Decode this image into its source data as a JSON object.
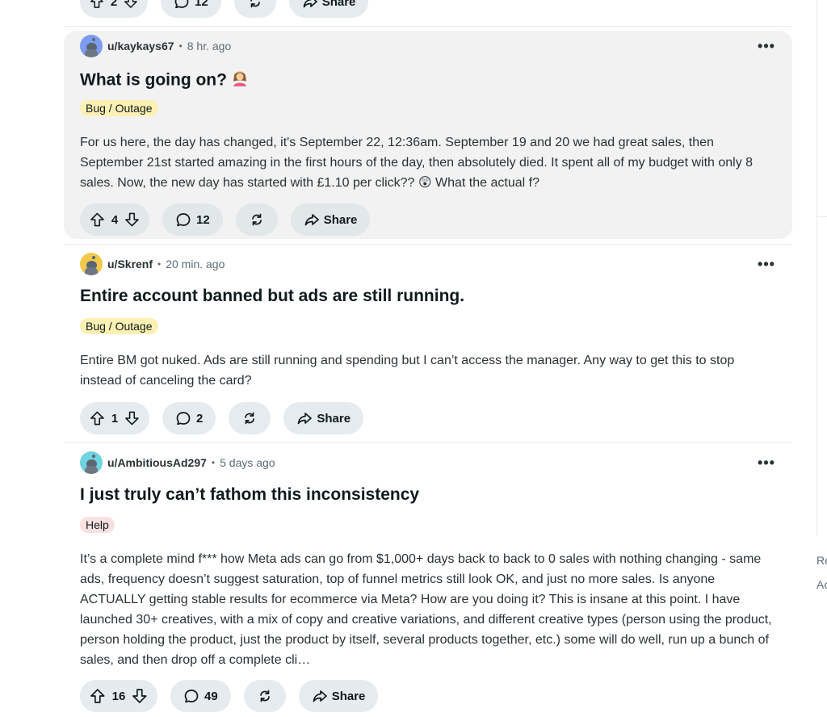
{
  "top_post": {
    "votes": "2",
    "comments": "12",
    "share_label": "Share"
  },
  "posts": [
    {
      "username": "u/kaykays67",
      "time": "8 hr. ago",
      "avatar_color": "#7d9cf0",
      "title": "What is going on?",
      "title_emoji": "woman-facepalming-emoji",
      "flair": "Bug / Outage",
      "body": "For us here, the day has changed, it's September 22, 12:36am. September 19 and 20 we had great sales, then September 21st started amazing in the first hours of the day, then absolutely died. It spent all of my budget with only 8 sales. Now, the new day has started with £1.10 per click?? 😲 What the actual f?",
      "votes": "4",
      "comments": "12",
      "share_label": "Share"
    },
    {
      "username": "u/Skrenf",
      "time": "20 min. ago",
      "avatar_color": "#f2c94c",
      "title": "Entire account banned but ads are still running.",
      "flair": "Bug / Outage",
      "body": "Entire BM got nuked. Ads are still running and spending but I can’t access the manager. Any way to get this to stop instead of canceling the card?",
      "votes": "1",
      "comments": "2",
      "share_label": "Share"
    },
    {
      "username": "u/AmbitiousAd297",
      "time": "5 days ago",
      "avatar_color": "#6fd3e0",
      "title": "I just truly can’t fathom this inconsistency",
      "flair": "Help",
      "body": "It’s a complete mind f*** how Meta ads can go from $1,000+ days back to back to 0 sales with nothing changing - same ads, frequency doesn’t suggest saturation, top of funnel metrics still look OK, and just no more sales. Is anyone ACTUALLY getting stable results for ecommerce via Meta? How are you doing it? This is insane at this point. I have launched 30+ creatives, with a mix of copy and creative variations, and different creative types (person using the product, person holding the product, just the product by itself, several products together, etc.) some will do well, run up a bunch of sales, and then drop off a complete cli…",
      "votes": "16",
      "comments": "49",
      "share_label": "Share"
    }
  ],
  "right_rail": {
    "line1": "Re",
    "line2": "Ac"
  },
  "colors": {
    "pill_bg": "#e5ebee",
    "hover_bg": "#f2f2f2",
    "flair_bug": "#fcf0b3",
    "flair_help": "#fae1e1"
  }
}
